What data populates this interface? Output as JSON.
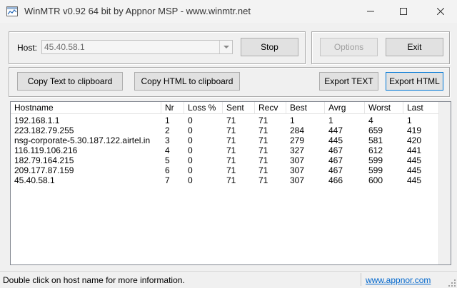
{
  "window": {
    "title": "WinMTR v0.92 64 bit by Appnor MSP - www.winmtr.net"
  },
  "host": {
    "label": "Host:",
    "value": "45.40.58.1"
  },
  "buttons": {
    "stop": "Stop",
    "options": "Options",
    "exit": "Exit",
    "copy_text": "Copy Text to clipboard",
    "copy_html": "Copy HTML to clipboard",
    "export_text": "Export TEXT",
    "export_html": "Export HTML"
  },
  "table": {
    "columns": [
      "Hostname",
      "Nr",
      "Loss %",
      "Sent",
      "Recv",
      "Best",
      "Avrg",
      "Worst",
      "Last"
    ],
    "rows": [
      [
        "192.168.1.1",
        "1",
        "0",
        "71",
        "71",
        "1",
        "1",
        "4",
        "1"
      ],
      [
        "223.182.79.255",
        "2",
        "0",
        "71",
        "71",
        "284",
        "447",
        "659",
        "419"
      ],
      [
        "nsg-corporate-5.30.187.122.airtel.in",
        "3",
        "0",
        "71",
        "71",
        "279",
        "445",
        "581",
        "420"
      ],
      [
        "116.119.106.216",
        "4",
        "0",
        "71",
        "71",
        "327",
        "467",
        "612",
        "441"
      ],
      [
        "182.79.164.215",
        "5",
        "0",
        "71",
        "71",
        "307",
        "467",
        "599",
        "445"
      ],
      [
        "209.177.87.159",
        "6",
        "0",
        "71",
        "71",
        "307",
        "467",
        "599",
        "445"
      ],
      [
        "45.40.58.1",
        "7",
        "0",
        "71",
        "71",
        "307",
        "466",
        "600",
        "445"
      ]
    ]
  },
  "status": {
    "message": "Double click on host name for more information.",
    "link": "www.appnor.com"
  },
  "icons": {
    "app": "winmtr-app-icon",
    "minimize": "minimize-icon",
    "maximize": "maximize-icon",
    "close": "close-icon",
    "dropdown": "chevron-down-icon"
  }
}
